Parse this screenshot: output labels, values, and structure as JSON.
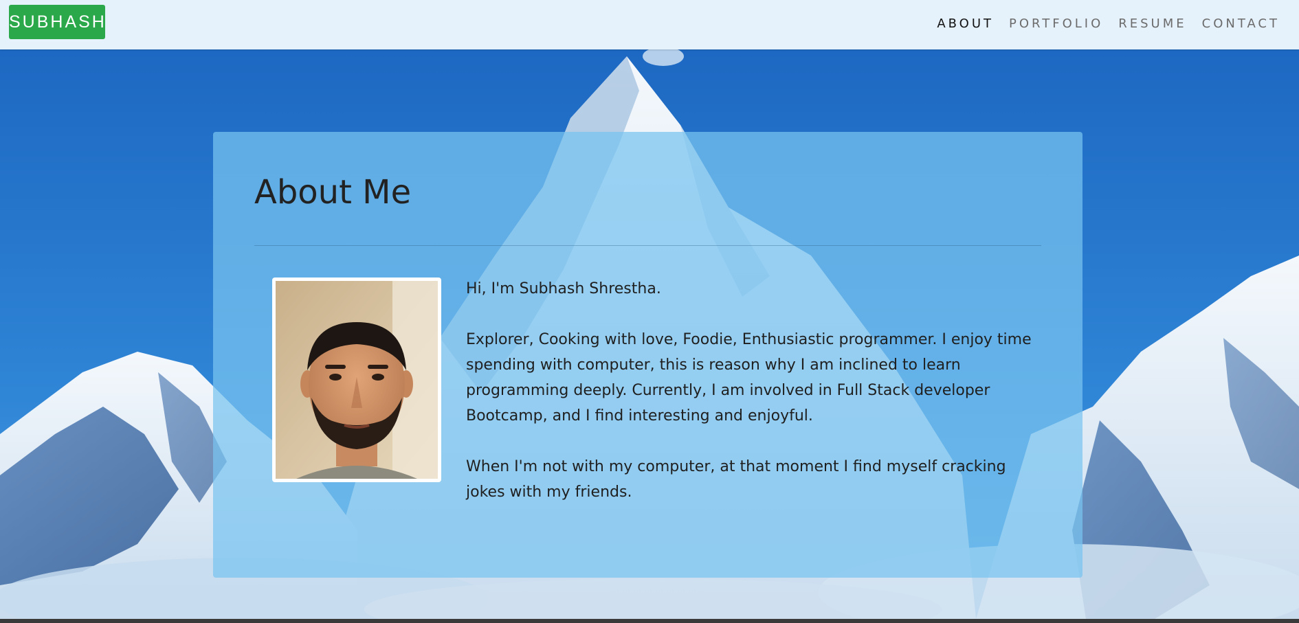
{
  "navbar": {
    "brand": "SUBHASH",
    "links": [
      {
        "label": "ABOUT",
        "active": true
      },
      {
        "label": "PORTFOLIO",
        "active": false
      },
      {
        "label": "RESUME",
        "active": false
      },
      {
        "label": "CONTACT",
        "active": false
      }
    ]
  },
  "about": {
    "title": "About Me",
    "paragraphs": [
      "Hi, I'm Subhash Shrestha.",
      "Explorer, Cooking with love, Foodie, Enthusiastic programmer. I enjoy time spending with computer, this is reason why I am inclined to learn programming deeply. Currently, I am involved in Full Stack developer Bootcamp, and I find interesting and enjoyful.",
      "When I'm not with my computer, at that moment I find myself cracking jokes with my friends."
    ]
  },
  "colors": {
    "brand_bg": "#2ba84a",
    "navbar_bg": "#e6f2fb",
    "card_bg": "rgba(120,196,240,0.72)",
    "sky": "#1f6fc4"
  }
}
